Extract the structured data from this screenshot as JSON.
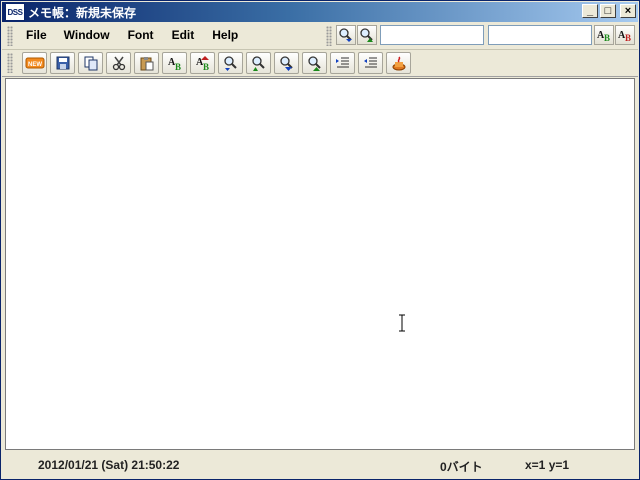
{
  "window": {
    "icon_text": "DSS",
    "title": "メモ帳：新規未保存",
    "controls": {
      "minimize": "_",
      "maximize": "□",
      "close": "×"
    }
  },
  "menu": {
    "items": [
      {
        "label": "File"
      },
      {
        "label": "Window"
      },
      {
        "label": "Font"
      },
      {
        "label": "Edit"
      },
      {
        "label": "Help"
      }
    ]
  },
  "search": {
    "find_value": "",
    "replace_value": ""
  },
  "toolbar": {
    "new_label": "NEW",
    "icons": [
      "new-icon",
      "save-icon",
      "copy-icon",
      "cut-icon",
      "paste-icon",
      "font-icon",
      "font-size-icon",
      "find-icon",
      "find-next-icon",
      "find-down-icon",
      "find-up-icon",
      "indent-icon",
      "outdent-icon",
      "run-icon"
    ]
  },
  "editor": {
    "content": ""
  },
  "status": {
    "datetime": "2012/01/21 (Sat) 21:50:22",
    "size": "0バイト",
    "position": "x=1 y=1"
  },
  "colors": {
    "titlebar_start": "#0a246a",
    "titlebar_end": "#a6caf0",
    "chrome": "#ece9d8",
    "editor_bg": "#ffffff"
  }
}
